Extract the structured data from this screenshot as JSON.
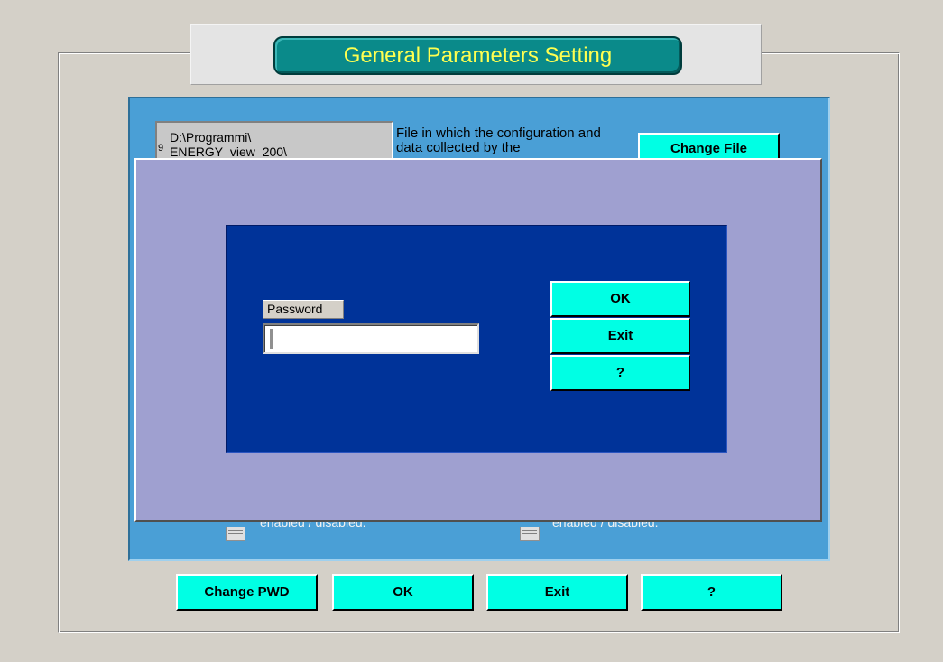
{
  "window": {
    "title": "General Parameters Setting"
  },
  "file_section": {
    "path_line1": "D:\\Programmi\\",
    "path_line2": "ENERGY_view_200\\",
    "path_mark": "9",
    "description": "File in which the configuration and data collected by the",
    "change_file_label": "Change File"
  },
  "toggles": {
    "left_label": "enabled / disabled.",
    "right_label": "enabled / disabled."
  },
  "password_dialog": {
    "password_label": "Password",
    "password_value": "",
    "ok_label": "OK",
    "exit_label": "Exit",
    "help_label": "?"
  },
  "bottom_buttons": {
    "change_pwd_label": "Change PWD",
    "ok_label": "OK",
    "exit_label": "Exit",
    "help_label": "?"
  },
  "colors": {
    "background": "#d4d0c8",
    "title_badge": "#0a8a8a",
    "title_text": "#ffff50",
    "blue_panel": "#4a9fd6",
    "modal": "#9fa0d0",
    "dark_panel": "#003399",
    "button": "#00ffe4"
  }
}
